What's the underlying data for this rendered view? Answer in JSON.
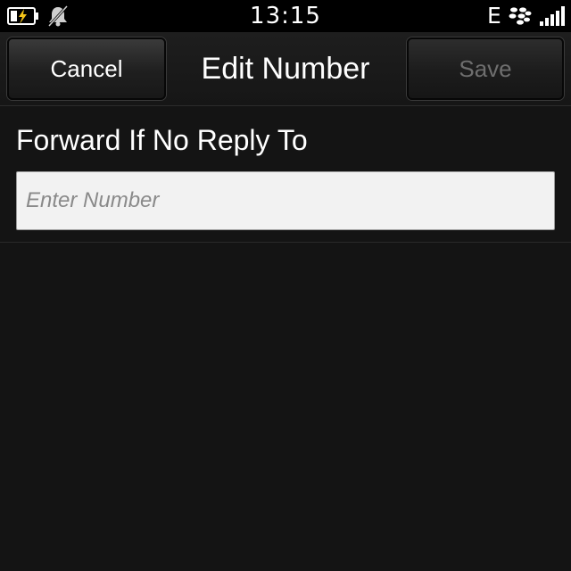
{
  "status_bar": {
    "time": "13:15",
    "network_type": "E",
    "icons": [
      "battery-charging-icon",
      "bell-muted-icon",
      "blackberry-logo-icon",
      "signal-strength-icon"
    ]
  },
  "title_bar": {
    "cancel_label": "Cancel",
    "title": "Edit Number",
    "save_label": "Save"
  },
  "form": {
    "label": "Forward If No Reply To",
    "input_value": "",
    "input_placeholder": "Enter Number"
  },
  "colors": {
    "background": "#141414",
    "status_bar": "#000000",
    "charging_bolt": "#f5c518",
    "disabled_text": "#6e6e6e",
    "input_background": "#f2f2f2"
  }
}
